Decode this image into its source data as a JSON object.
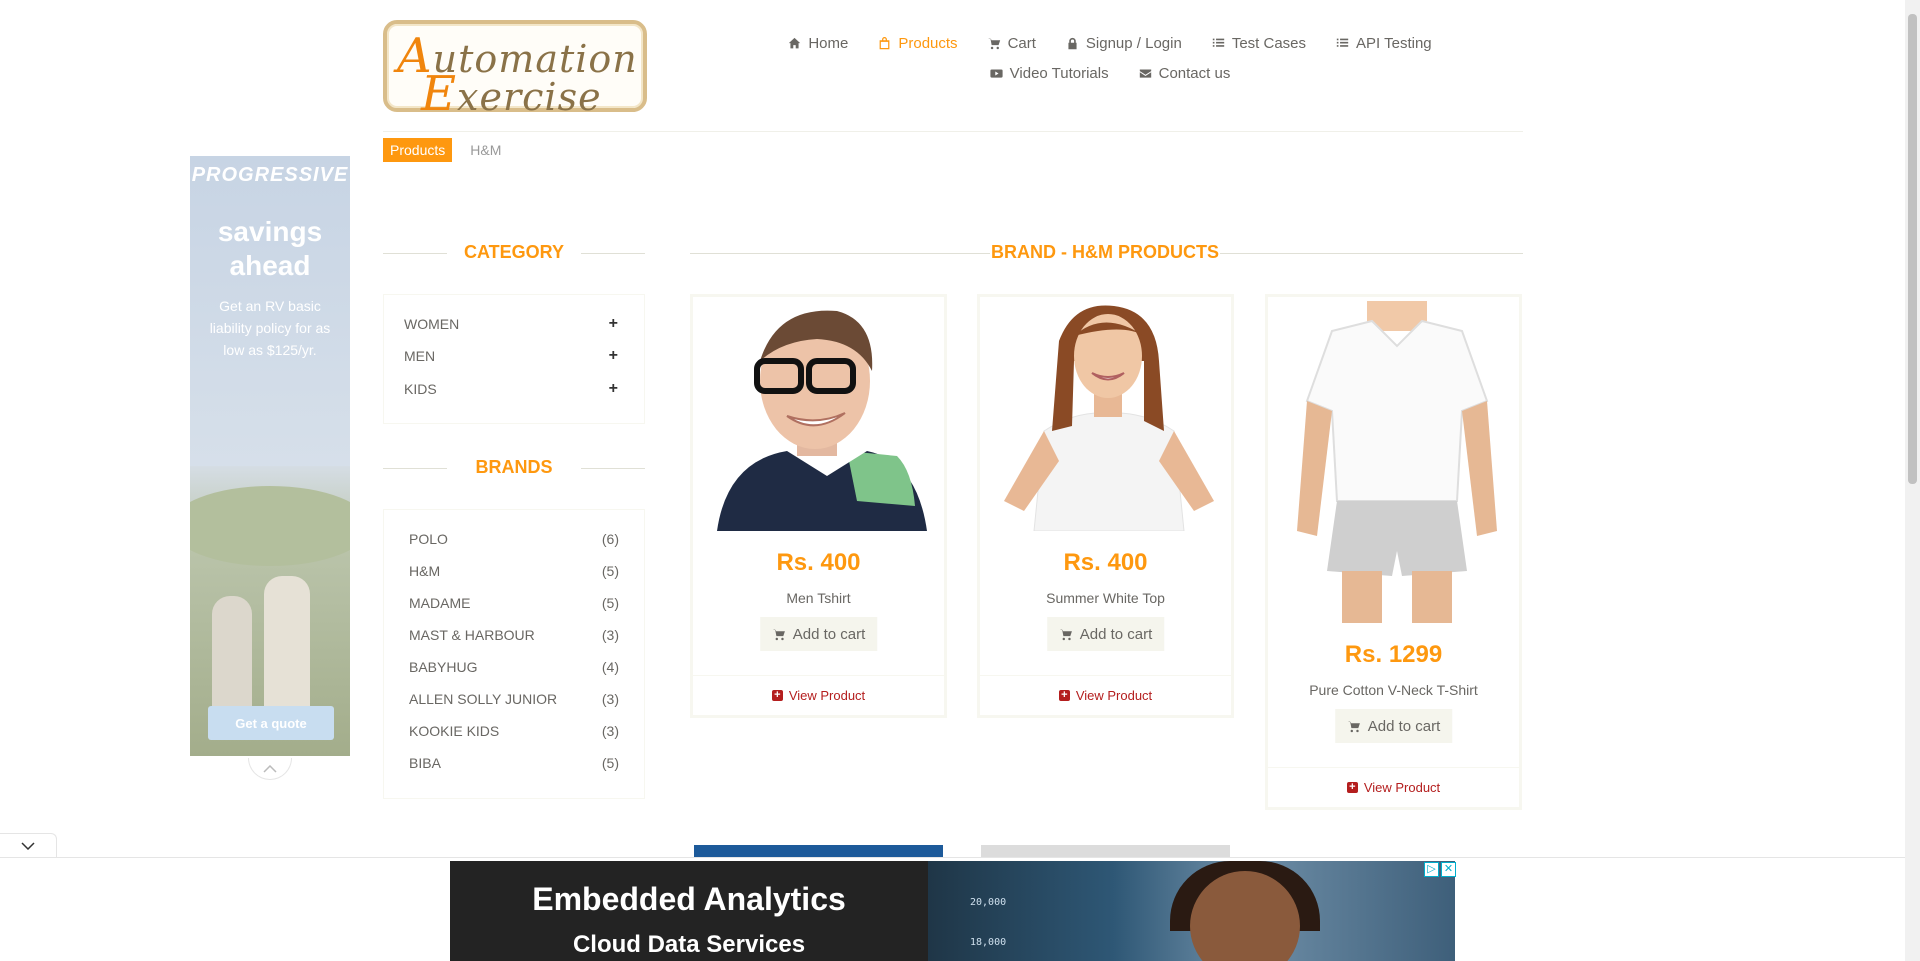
{
  "header": {
    "logo_line1": "Automation",
    "logo_line2": "Exercise",
    "nav": [
      {
        "label": "Home",
        "icon": "home-icon"
      },
      {
        "label": "Products",
        "icon": "shopping-bag-icon",
        "active": true
      },
      {
        "label": "Cart",
        "icon": "cart-icon"
      },
      {
        "label": "Signup / Login",
        "icon": "lock-icon"
      },
      {
        "label": "Test Cases",
        "icon": "list-icon"
      },
      {
        "label": "API Testing",
        "icon": "list-icon"
      },
      {
        "label": "Video Tutorials",
        "icon": "youtube-play-icon"
      },
      {
        "label": "Contact us",
        "icon": "envelope-icon"
      }
    ]
  },
  "breadcrumb": {
    "active": "Products",
    "current": "H&M"
  },
  "side_ad": {
    "brand": "PROGRESSIVE",
    "headline": "savings ahead",
    "text": "Get an RV basic liability policy for as low as $125/yr.",
    "cta": "Get a quote"
  },
  "sidebar": {
    "category_title": "CATEGORY",
    "categories": [
      "WOMEN",
      "MEN",
      "KIDS"
    ],
    "brands_title": "BRANDS",
    "brands": [
      {
        "name": "POLO",
        "count": "(6)"
      },
      {
        "name": "H&M",
        "count": "(5)"
      },
      {
        "name": "MADAME",
        "count": "(5)"
      },
      {
        "name": "MAST & HARBOUR",
        "count": "(3)"
      },
      {
        "name": "BABYHUG",
        "count": "(4)"
      },
      {
        "name": "ALLEN SOLLY JUNIOR",
        "count": "(3)"
      },
      {
        "name": "KOOKIE KIDS",
        "count": "(3)"
      },
      {
        "name": "BIBA",
        "count": "(5)"
      }
    ]
  },
  "main": {
    "title": "BRAND - H&M PRODUCTS",
    "products": [
      {
        "price": "Rs. 400",
        "name": "Men Tshirt",
        "add_label": "Add to cart",
        "view_label": "View Product"
      },
      {
        "price": "Rs. 400",
        "name": "Summer White Top",
        "add_label": "Add to cart",
        "view_label": "View Product"
      },
      {
        "price": "Rs. 1299",
        "name": "Pure Cotton V-Neck T-Shirt",
        "add_label": "Add to cart",
        "view_label": "View Product"
      }
    ]
  },
  "bottom_ad": {
    "headline": "Embedded Analytics",
    "subline": "Cloud Data Services",
    "numbers": [
      "20,000",
      "18,000"
    ]
  },
  "colors": {
    "accent": "#fe980f",
    "text": "#696763",
    "view_product": "#b41e1e"
  }
}
